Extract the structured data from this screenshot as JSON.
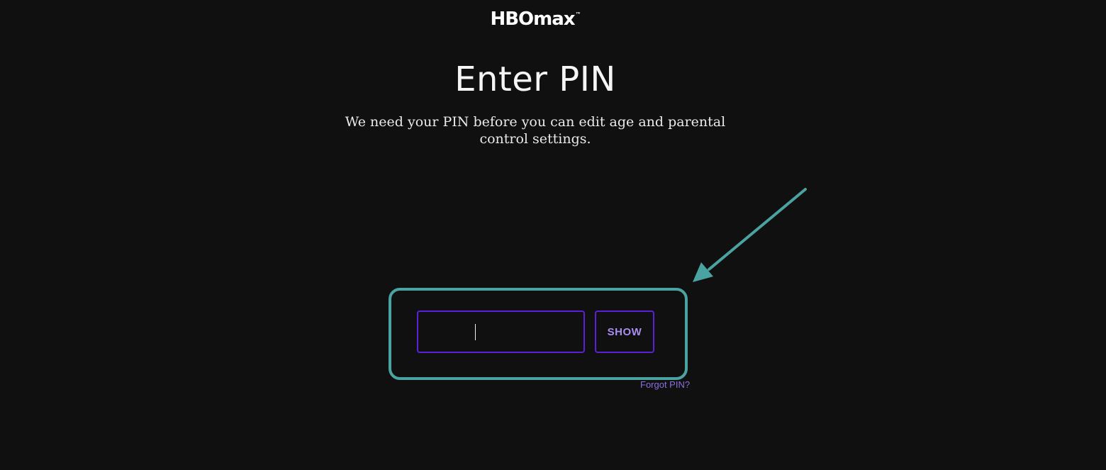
{
  "header": {
    "logo_text": "HBOmax",
    "logo_mark": "™"
  },
  "main": {
    "title": "Enter PIN",
    "description": "We need your PIN before you can edit age and parental control settings.",
    "pin_input": {
      "value": "",
      "placeholder": ""
    },
    "show_label": "SHOW",
    "forgot_label": "Forgot PIN?"
  },
  "colors": {
    "background": "#101010",
    "accent": "#5a22d6",
    "button_text": "#a98ef0",
    "link": "#8c6fe0",
    "annotation": "#4aa3a0"
  },
  "icons": {
    "annotation_arrow": "arrow-icon"
  }
}
